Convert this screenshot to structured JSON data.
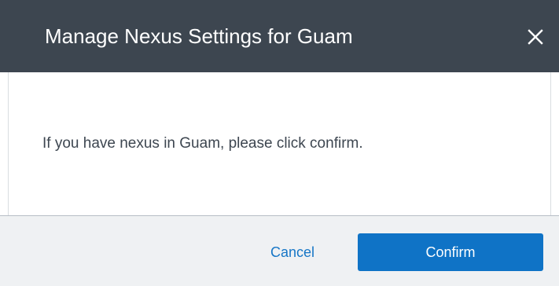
{
  "dialog": {
    "title": "Manage Nexus Settings for Guam",
    "close_icon": "close-icon",
    "message": "If you have nexus in Guam, please click confirm.",
    "buttons": {
      "cancel_label": "Cancel",
      "confirm_label": "Confirm"
    }
  },
  "colors": {
    "header_background": "#3d4650",
    "footer_background": "#eff1f3",
    "primary_button": "#0f73c6",
    "link_text": "#1676c6",
    "message_text": "#3d4650"
  }
}
